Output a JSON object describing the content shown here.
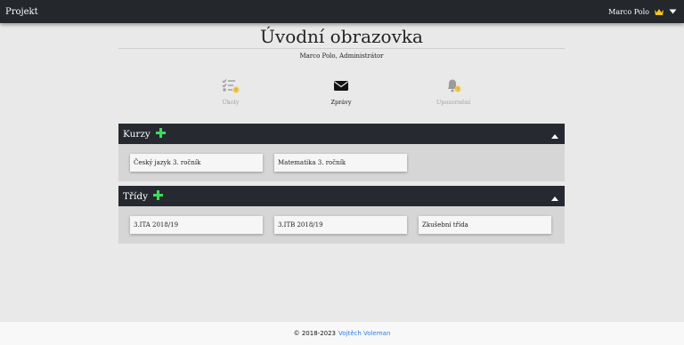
{
  "navbar": {
    "brand": "Projekt",
    "user_name": "Marco Polo"
  },
  "header": {
    "title": "Úvodní obrazovka",
    "subtitle": "Marco Polo, Administrátor"
  },
  "quick_links": [
    {
      "label": "Úkoly",
      "icon": "tasks-icon",
      "state": "disabled"
    },
    {
      "label": "Zprávy",
      "icon": "envelope-icon",
      "state": "active"
    },
    {
      "label": "Upozornění",
      "icon": "bell-icon",
      "state": "disabled"
    }
  ],
  "sections": {
    "courses": {
      "title": "Kurzy",
      "items": [
        "Český jazyk 3. ročník",
        "Matematika 3. ročník"
      ]
    },
    "classes": {
      "title": "Třídy",
      "items": [
        "3.ITA 2018/19",
        "3.ITB 2018/19",
        "Zkušební třída"
      ]
    }
  },
  "footer": {
    "copyright": "© 2018-2023",
    "author": "Vojtěch Voleman"
  },
  "colors": {
    "navbar": "#24272c",
    "add_icon": "#3ddc5c",
    "crown": "#f5c518",
    "badge": "#f0c94a",
    "link": "#2a7fdd"
  }
}
